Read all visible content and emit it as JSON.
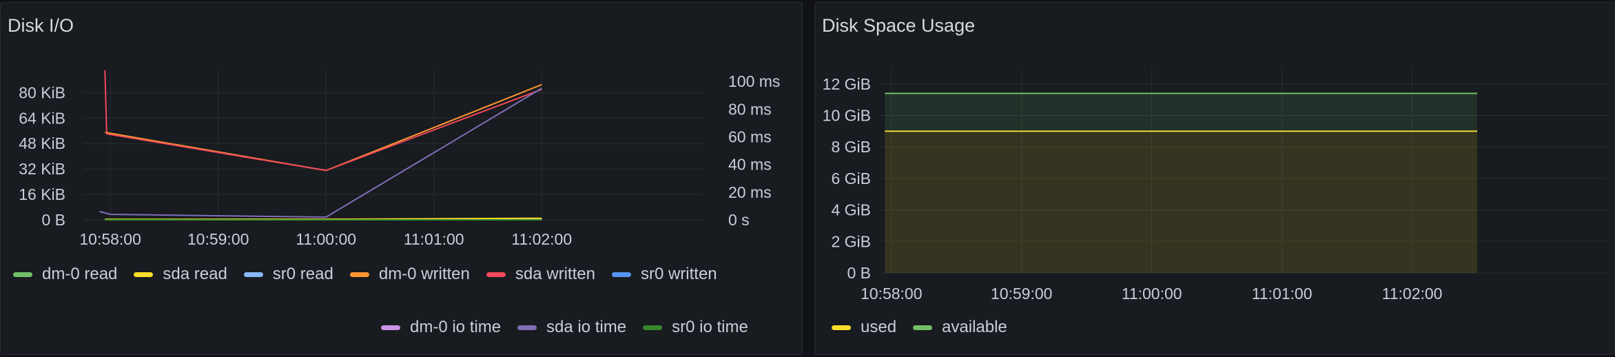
{
  "panels": {
    "left_title": "Disk I/O",
    "right_title": "Disk Space Usage"
  },
  "chart_data": [
    {
      "type": "line",
      "title": "Disk I/O",
      "x_ticks": [
        "10:58:00",
        "10:59:00",
        "11:00:00",
        "11:01:00",
        "11:02:00"
      ],
      "x_range": [
        "10:57:45",
        "11:03:30"
      ],
      "y_left": {
        "ticks": [
          "0 B",
          "16 KiB",
          "32 KiB",
          "48 KiB",
          "64 KiB",
          "80 KiB"
        ],
        "range_kib": [
          0,
          94
        ]
      },
      "y_right": {
        "ticks": [
          "0 s",
          "20 ms",
          "40 ms",
          "60 ms",
          "80 ms",
          "100 ms"
        ],
        "range_ms": [
          0,
          108
        ]
      },
      "grid": true,
      "legend_placement": "bottom",
      "series": [
        {
          "name": "dm-0 read",
          "color": "#73bf69",
          "axis": "left",
          "points": [
            [
              "10:57:57",
              0.3
            ],
            [
              "11:00:00",
              0.3
            ],
            [
              "11:02:00",
              0.8
            ]
          ]
        },
        {
          "name": "sda read",
          "color": "#fade2a",
          "axis": "left",
          "points": [
            [
              "10:57:57",
              0.3
            ],
            [
              "11:00:00",
              0.4
            ],
            [
              "11:02:00",
              1.0
            ]
          ]
        },
        {
          "name": "sr0 read",
          "color": "#8ab8ff",
          "axis": "left",
          "points": [
            [
              "10:57:57",
              0
            ],
            [
              "11:02:00",
              0
            ]
          ]
        },
        {
          "name": "dm-0 written",
          "color": "#ff9830",
          "axis": "left",
          "points": [
            [
              "10:57:57",
              55
            ],
            [
              "11:00:00",
              31
            ],
            [
              "11:02:00",
              85
            ]
          ]
        },
        {
          "name": "sda written",
          "color": "#f2495c",
          "axis": "left",
          "points": [
            [
              "10:57:57",
              94
            ],
            [
              "10:57:58",
              54
            ],
            [
              "11:00:00",
              31
            ],
            [
              "11:02:00",
              82
            ]
          ]
        },
        {
          "name": "sr0 written",
          "color": "#5794f2",
          "axis": "left",
          "points": [
            [
              "10:57:57",
              0
            ],
            [
              "11:02:00",
              0
            ]
          ]
        },
        {
          "name": "dm-0 io time",
          "color": "#ca95e5",
          "axis": "right",
          "points": [
            [
              "10:57:57",
              0
            ],
            [
              "11:02:00",
              0
            ]
          ]
        },
        {
          "name": "sda io time",
          "color": "#806eb7",
          "axis": "right",
          "points": [
            [
              "10:57:54",
              6
            ],
            [
              "10:58:00",
              4
            ],
            [
              "11:00:00",
              2
            ],
            [
              "11:02:00",
              95
            ]
          ]
        },
        {
          "name": "sr0 io time",
          "color": "#37872d",
          "axis": "right",
          "points": [
            [
              "10:57:57",
              0
            ],
            [
              "11:02:00",
              0
            ]
          ]
        }
      ],
      "legend_rows": [
        [
          "dm-0 read",
          "sda read",
          "sr0 read",
          "dm-0 written",
          "sda written",
          "sr0 written"
        ],
        [
          "dm-0 io time",
          "sda io time",
          "sr0 io time"
        ]
      ]
    },
    {
      "type": "area",
      "title": "Disk Space Usage",
      "x_ticks": [
        "10:58:00",
        "10:59:00",
        "11:00:00",
        "11:01:00",
        "11:02:00"
      ],
      "x_range": [
        "10:57:55",
        "11:03:30"
      ],
      "y_ticks": [
        "0 B",
        "2 GiB",
        "4 GiB",
        "6 GiB",
        "8 GiB",
        "10 GiB",
        "12 GiB"
      ],
      "y_range_gib": [
        0,
        13
      ],
      "grid": true,
      "stacked": true,
      "legend_placement": "bottom-left",
      "series": [
        {
          "name": "used",
          "color": "#fade2a",
          "values_gib": [
            9.0,
            9.0
          ],
          "x": [
            "10:57:57",
            "11:02:30"
          ]
        },
        {
          "name": "available",
          "color": "#73bf69",
          "values_gib": [
            2.4,
            2.4
          ],
          "x": [
            "10:57:57",
            "11:02:30"
          ]
        }
      ]
    }
  ]
}
